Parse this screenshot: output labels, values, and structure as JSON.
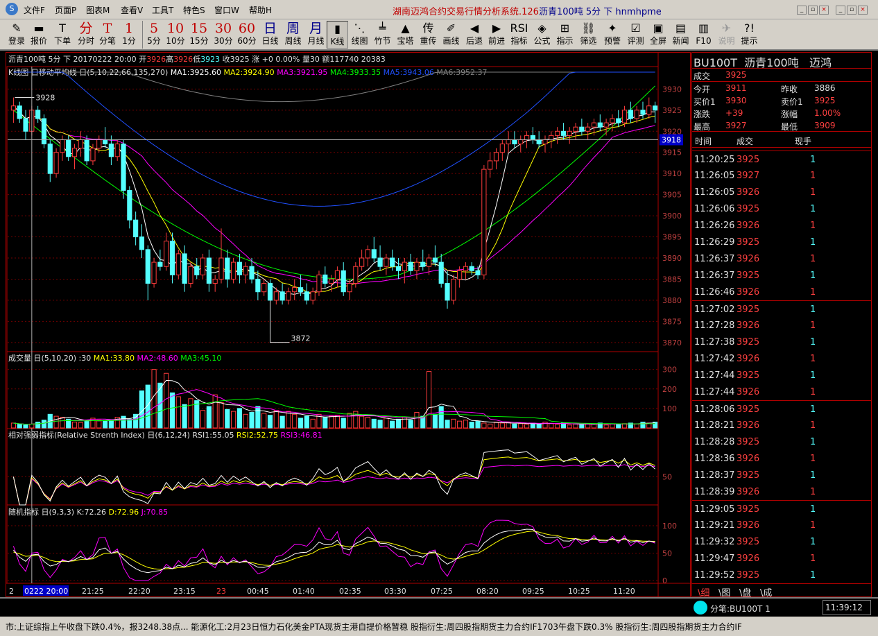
{
  "app": {
    "title": "湖南迈鸿合约交易行情分析系统.126",
    "title_symbol": "沥青100吨 5分 下 hnmhpme",
    "menu": [
      "文件F",
      "页面P",
      "图表M",
      "查看V",
      "工具T",
      "特色S",
      "窗口W",
      "帮助H"
    ]
  },
  "toolbar": [
    {
      "icon": "pencil-icon",
      "glyph": "✎",
      "label": "登录"
    },
    {
      "icon": "report-icon",
      "glyph": "▬",
      "label": "报价"
    },
    {
      "icon": "order-icon",
      "glyph": "T",
      "label": "下单"
    },
    {
      "icon": "fenshi-icon",
      "glyph": "分",
      "label": "分时"
    },
    {
      "icon": "fenbi-icon",
      "glyph": "T",
      "label": "分笔"
    },
    {
      "icon": "oneminute-icon",
      "glyph": "1",
      "label": "1分"
    },
    {
      "icon": "five-icon",
      "glyph": "5",
      "label": "5分"
    },
    {
      "icon": "ten-icon",
      "glyph": "10",
      "label": "10分"
    },
    {
      "icon": "fifteen-icon",
      "glyph": "15",
      "label": "15分"
    },
    {
      "icon": "thirty-icon",
      "glyph": "30",
      "label": "30分"
    },
    {
      "icon": "sixty-icon",
      "glyph": "60",
      "label": "60分"
    },
    {
      "icon": "day-icon",
      "glyph": "日",
      "label": "日线"
    },
    {
      "icon": "week-icon",
      "glyph": "周",
      "label": "周线"
    },
    {
      "icon": "month-icon",
      "glyph": "月",
      "label": "月线"
    },
    {
      "icon": "kline-icon",
      "glyph": "▮",
      "label": "K线"
    },
    {
      "icon": "lineChart-icon",
      "glyph": "⋱",
      "label": "线图"
    },
    {
      "icon": "bamboo-icon",
      "glyph": "╧",
      "label": "竹节"
    },
    {
      "icon": "tower-icon",
      "glyph": "▲",
      "label": "宝塔"
    },
    {
      "icon": "chong-icon",
      "glyph": "传",
      "label": "重传"
    },
    {
      "icon": "draw-icon",
      "glyph": "✐",
      "label": "画线"
    },
    {
      "icon": "back-icon",
      "glyph": "◀",
      "label": "后退"
    },
    {
      "icon": "forward-icon",
      "glyph": "▶",
      "label": "前进"
    },
    {
      "icon": "rsi-icon",
      "glyph": "RSI",
      "label": "指标"
    },
    {
      "icon": "formula-icon",
      "glyph": "◈",
      "label": "公式"
    },
    {
      "icon": "indicate-icon",
      "glyph": "⊞",
      "label": "指示"
    },
    {
      "icon": "filter-icon",
      "glyph": "⛓",
      "label": "筛选"
    },
    {
      "icon": "alarm-icon",
      "glyph": "✦",
      "label": "预警"
    },
    {
      "icon": "evaluate-icon",
      "glyph": "☑",
      "label": "评测"
    },
    {
      "icon": "fullscreen-icon",
      "glyph": "▣",
      "label": "全屏"
    },
    {
      "icon": "news-icon",
      "glyph": "▤",
      "label": "新闻"
    },
    {
      "icon": "f10-icon",
      "glyph": "▥",
      "label": "F10"
    },
    {
      "icon": "help-icon",
      "glyph": "✈",
      "label": "说明"
    },
    {
      "icon": "tip-icon",
      "glyph": "?!",
      "label": "提示"
    }
  ],
  "chart": {
    "info_line": {
      "symbol": "沥青100吨 5分 下",
      "date": "20170222 20:00",
      "open_label": "开",
      "open": "3926",
      "high_label": "高",
      "high": "3926",
      "low_label": "低",
      "low": "3923",
      "close_label": "收",
      "close": "3925",
      "chg": "涨 +0 0.00%",
      "vol": "量30 额117740 20383"
    },
    "ma_header": {
      "label": "K线图 日移动平均线 日(5,10,22,66,135,270)",
      "ma1": "MA1:3925.60",
      "ma2": "MA2:3924.90",
      "ma3": "MA3:3921.95",
      "ma4": "MA4:3933.35",
      "ma5": "MA5:3943.06",
      "ma6": "MA6:3952.37"
    },
    "price_axis": [
      "3930",
      "3925",
      "3920",
      "3915",
      "3910",
      "3905",
      "3900",
      "3895",
      "3890",
      "3885",
      "3880",
      "3875",
      "3870"
    ],
    "high_label": "3928",
    "low_label": "3872",
    "current_price": "3918",
    "vol_header": {
      "label": "成交量 日(5,10,20)",
      "v": ":30",
      "ma1": "MA1:33.80",
      "ma2": "MA2:48.60",
      "ma3": "MA3:45.10"
    },
    "vol_axis": [
      "300",
      "200",
      "100"
    ],
    "rsi_header": {
      "label": "相对强弱指标(Relative Strenth Index) 日(6,12,24)",
      "rsi1": "RSI1:55.05",
      "rsi2": "RSI2:52.75",
      "rsi3": "RSI3:46.81"
    },
    "rsi_axis": [
      "50"
    ],
    "kdj_header": {
      "label": "随机指标 日(9,3,3)",
      "k": "K:72.26",
      "d": "D:72.96",
      "j": "J:70.85"
    },
    "kdj_axis": [
      "100",
      "50",
      "0"
    ],
    "time_axis": [
      "2",
      "0222 20:00",
      "21:25",
      "22:20",
      "23:15",
      "23",
      "00:45",
      "01:40",
      "02:35",
      "03:30",
      "07:25",
      "08:20",
      "09:25",
      "10:25",
      "11:20"
    ]
  },
  "chart_data": {
    "type": "candlestick",
    "ylim": [
      3868,
      3934
    ],
    "candles": [
      [
        3925,
        3928,
        3922,
        3926
      ],
      [
        3926,
        3927,
        3922,
        3923
      ],
      [
        3923,
        3925,
        3918,
        3920
      ],
      [
        3920,
        3926,
        3919,
        3925
      ],
      [
        3925,
        3926,
        3922,
        3923
      ],
      [
        3923,
        3924,
        3916,
        3917
      ],
      [
        3917,
        3918,
        3908,
        3910
      ],
      [
        3910,
        3916,
        3909,
        3915
      ],
      [
        3915,
        3919,
        3913,
        3918
      ],
      [
        3918,
        3919,
        3913,
        3914
      ],
      [
        3914,
        3917,
        3911,
        3916
      ],
      [
        3916,
        3920,
        3914,
        3918
      ],
      [
        3918,
        3919,
        3912,
        3913
      ],
      [
        3913,
        3917,
        3912,
        3916
      ],
      [
        3916,
        3919,
        3915,
        3918
      ],
      [
        3918,
        3921,
        3916,
        3917
      ],
      [
        3917,
        3919,
        3912,
        3914
      ],
      [
        3914,
        3918,
        3913,
        3917
      ],
      [
        3917,
        3918,
        3904,
        3906
      ],
      [
        3906,
        3907,
        3897,
        3899
      ],
      [
        3899,
        3901,
        3893,
        3895
      ],
      [
        3895,
        3898,
        3890,
        3892
      ],
      [
        3892,
        3893,
        3880,
        3884
      ],
      [
        3884,
        3890,
        3883,
        3889
      ],
      [
        3889,
        3892,
        3887,
        3888
      ],
      [
        3888,
        3896,
        3887,
        3894
      ],
      [
        3894,
        3896,
        3884,
        3886
      ],
      [
        3886,
        3892,
        3885,
        3891
      ],
      [
        3891,
        3893,
        3882,
        3884
      ],
      [
        3884,
        3889,
        3883,
        3888
      ],
      [
        3888,
        3890,
        3885,
        3886
      ],
      [
        3886,
        3891,
        3885,
        3890
      ],
      [
        3890,
        3892,
        3882,
        3884
      ],
      [
        3884,
        3886,
        3882,
        3885
      ],
      [
        3885,
        3897,
        3884,
        3890
      ],
      [
        3890,
        3892,
        3883,
        3885
      ],
      [
        3885,
        3890,
        3884,
        3889
      ],
      [
        3889,
        3891,
        3884,
        3886
      ],
      [
        3886,
        3889,
        3884,
        3888
      ],
      [
        3888,
        3890,
        3884,
        3885
      ],
      [
        3885,
        3887,
        3880,
        3882
      ],
      [
        3882,
        3885,
        3881,
        3884
      ],
      [
        3884,
        3885,
        3872,
        3880
      ],
      [
        3880,
        3883,
        3879,
        3882
      ],
      [
        3882,
        3884,
        3879,
        3880
      ],
      [
        3880,
        3883,
        3879,
        3882
      ],
      [
        3882,
        3885,
        3880,
        3883
      ],
      [
        3883,
        3886,
        3881,
        3882
      ],
      [
        3882,
        3884,
        3879,
        3880
      ],
      [
        3880,
        3883,
        3879,
        3882
      ],
      [
        3882,
        3887,
        3881,
        3886
      ],
      [
        3886,
        3888,
        3883,
        3884
      ],
      [
        3884,
        3886,
        3882,
        3885
      ],
      [
        3885,
        3888,
        3883,
        3887
      ],
      [
        3887,
        3889,
        3881,
        3882
      ],
      [
        3882,
        3885,
        3880,
        3884
      ],
      [
        3884,
        3889,
        3883,
        3888
      ],
      [
        3888,
        3892,
        3887,
        3890
      ],
      [
        3890,
        3893,
        3888,
        3892
      ],
      [
        3892,
        3895,
        3889,
        3890
      ],
      [
        3890,
        3893,
        3887,
        3888
      ],
      [
        3888,
        3891,
        3886,
        3890
      ],
      [
        3890,
        3892,
        3887,
        3888
      ],
      [
        3888,
        3890,
        3885,
        3887
      ],
      [
        3887,
        3890,
        3884,
        3889
      ],
      [
        3889,
        3891,
        3886,
        3887
      ],
      [
        3887,
        3890,
        3885,
        3889
      ],
      [
        3889,
        3892,
        3887,
        3888
      ],
      [
        3888,
        3891,
        3886,
        3890
      ],
      [
        3890,
        3893,
        3888,
        3889
      ],
      [
        3889,
        3891,
        3883,
        3884
      ],
      [
        3884,
        3887,
        3878,
        3880
      ],
      [
        3880,
        3886,
        3879,
        3885
      ],
      [
        3885,
        3888,
        3883,
        3887
      ],
      [
        3887,
        3889,
        3885,
        3888
      ],
      [
        3888,
        3889,
        3886,
        3887
      ],
      [
        3887,
        3888,
        3885,
        3886
      ],
      [
        3886,
        3912,
        3885,
        3911
      ],
      [
        3911,
        3915,
        3909,
        3913
      ],
      [
        3913,
        3916,
        3911,
        3915
      ],
      [
        3915,
        3918,
        3913,
        3917
      ],
      [
        3917,
        3920,
        3915,
        3918
      ],
      [
        3918,
        3920,
        3916,
        3917
      ],
      [
        3917,
        3919,
        3915,
        3918
      ],
      [
        3918,
        3920,
        3916,
        3919
      ],
      [
        3919,
        3921,
        3917,
        3918
      ],
      [
        3918,
        3920,
        3916,
        3917
      ],
      [
        3917,
        3919,
        3915,
        3918
      ],
      [
        3918,
        3920,
        3916,
        3919
      ],
      [
        3919,
        3921,
        3917,
        3920
      ],
      [
        3920,
        3922,
        3918,
        3919
      ],
      [
        3919,
        3921,
        3917,
        3920
      ],
      [
        3920,
        3922,
        3918,
        3921
      ],
      [
        3921,
        3923,
        3919,
        3920
      ],
      [
        3920,
        3922,
        3918,
        3921
      ],
      [
        3921,
        3923,
        3919,
        3922
      ],
      [
        3922,
        3924,
        3920,
        3921
      ],
      [
        3921,
        3923,
        3919,
        3922
      ],
      [
        3922,
        3924,
        3920,
        3923
      ],
      [
        3923,
        3925,
        3921,
        3922
      ],
      [
        3922,
        3926,
        3921,
        3925
      ],
      [
        3925,
        3927,
        3922,
        3923
      ],
      [
        3923,
        3926,
        3922,
        3925
      ],
      [
        3925,
        3927,
        3923,
        3924
      ],
      [
        3924,
        3928,
        3923,
        3926
      ],
      [
        3926,
        3927,
        3922,
        3925
      ]
    ],
    "volumes": [
      25,
      18,
      15,
      20,
      30,
      40,
      70,
      60,
      55,
      45,
      30,
      28,
      35,
      50,
      40,
      38,
      42,
      55,
      60,
      45,
      70,
      190,
      220,
      300,
      230,
      280,
      180,
      160,
      120,
      150,
      140,
      90,
      110,
      170,
      130,
      95,
      85,
      100,
      70,
      80,
      110,
      75,
      65,
      90,
      60,
      85,
      70,
      50,
      60,
      45,
      70,
      55,
      60,
      65,
      50,
      75,
      85,
      60,
      55,
      45,
      40,
      50,
      35,
      45,
      55,
      40,
      80,
      60,
      290,
      70,
      110,
      40,
      45,
      35,
      40,
      30,
      35,
      25,
      20,
      30,
      25,
      28,
      20,
      22,
      18,
      25,
      20,
      30,
      22,
      18,
      25,
      15,
      20,
      18,
      22,
      20,
      25,
      15,
      20,
      18,
      22,
      25,
      20,
      30,
      25,
      30
    ],
    "ma_lines": [
      "MA1",
      "MA2",
      "MA3",
      "MA4",
      "MA5",
      "MA6"
    ],
    "colors": {
      "up": "#ff3c3c",
      "down": "#54ffff",
      "ma1": "#ffffff",
      "ma2": "#ffff00",
      "ma3": "#ff00ff",
      "ma4": "#00ff00",
      "ma5": "#0000ff",
      "ma6": "#808080",
      "grid": "#700000",
      "axis": "#b00000"
    }
  },
  "quote": {
    "code": "BU100T",
    "name": "沥青100吨",
    "exch": "迈鸿",
    "rows": [
      {
        "l1": "成交",
        "v1": "3925",
        "l2": "",
        "v2": ""
      },
      {
        "l1": "今开",
        "v1": "3911",
        "l2": "昨收",
        "v2": "3886"
      },
      {
        "l1": "买价1",
        "v1": "3930",
        "l2": "卖价1",
        "v2": "3925"
      },
      {
        "l1": "涨跌",
        "v1": "+39",
        "l2": "涨幅",
        "v2": "1.00%"
      },
      {
        "l1": "最高",
        "v1": "3927",
        "l2": "最低",
        "v2": "3909"
      }
    ],
    "ticks_header": [
      "时间",
      "成交",
      "现手"
    ],
    "ticks": [
      [
        "11:20:25",
        "3925",
        "1"
      ],
      [
        "11:26:05",
        "3927",
        "1"
      ],
      [
        "11:26:05",
        "3926",
        "1"
      ],
      [
        "11:26:06",
        "3925",
        "1"
      ],
      [
        "11:26:26",
        "3926",
        "1"
      ],
      [
        "11:26:29",
        "3925",
        "1"
      ],
      [
        "11:26:37",
        "3926",
        "1"
      ],
      [
        "11:26:37",
        "3925",
        "1"
      ],
      [
        "11:26:46",
        "3926",
        "1"
      ],
      [
        "11:27:02",
        "3925",
        "1"
      ],
      [
        "11:27:28",
        "3926",
        "1"
      ],
      [
        "11:27:38",
        "3925",
        "1"
      ],
      [
        "11:27:42",
        "3926",
        "1"
      ],
      [
        "11:27:44",
        "3925",
        "1"
      ],
      [
        "11:27:44",
        "3926",
        "1"
      ],
      [
        "11:28:06",
        "3925",
        "1"
      ],
      [
        "11:28:21",
        "3926",
        "1"
      ],
      [
        "11:28:28",
        "3925",
        "1"
      ],
      [
        "11:28:36",
        "3926",
        "1"
      ],
      [
        "11:28:37",
        "3925",
        "1"
      ],
      [
        "11:28:39",
        "3926",
        "1"
      ],
      [
        "11:29:05",
        "3925",
        "1"
      ],
      [
        "11:29:21",
        "3926",
        "1"
      ],
      [
        "11:29:32",
        "3925",
        "1"
      ],
      [
        "11:29:47",
        "3926",
        "1"
      ],
      [
        "11:29:52",
        "3925",
        "1"
      ]
    ],
    "bottom_tabs": [
      "细",
      "图",
      "盘",
      "成"
    ]
  },
  "status": {
    "fenbi": "分笔:BU100T 1",
    "time": "11:39:12"
  },
  "news": "市:上证综指上午收盘下跌0.4%，报3248.38点...    能源化工:2月23日恒力石化美金PTA现货主港自提价格暂稳    股指衍生:周四股指期货主力合约IF1703午盘下跌0.3%    股指衍生:周四股指期货主力合约IF"
}
